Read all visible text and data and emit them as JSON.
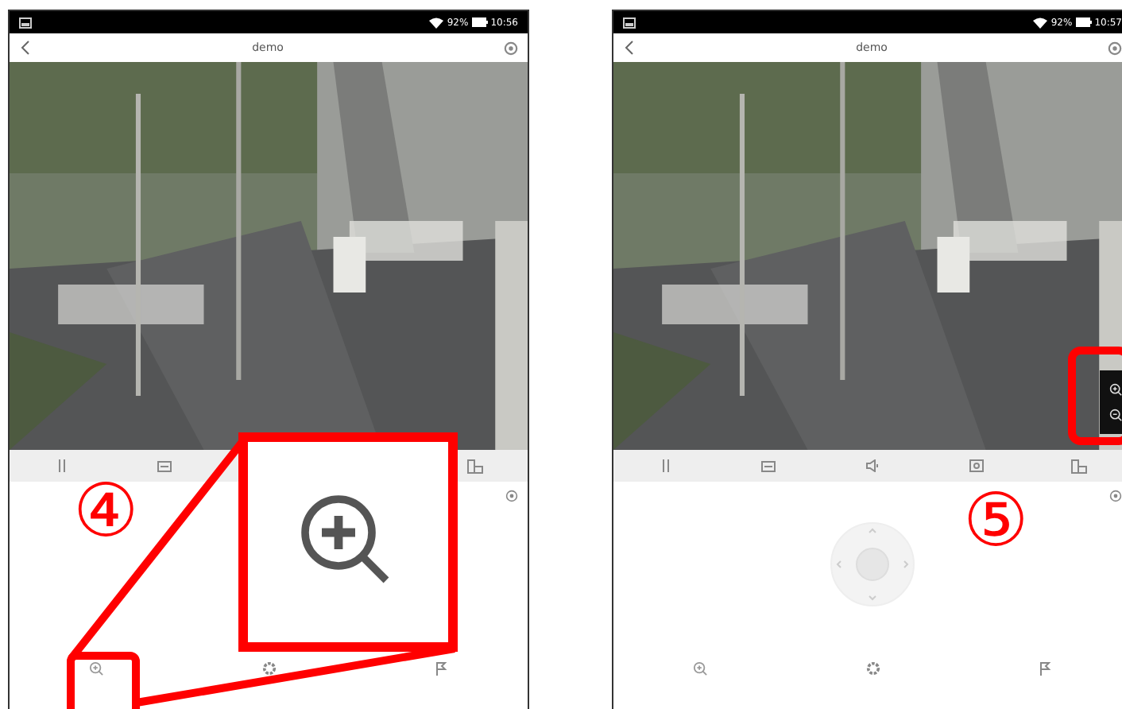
{
  "phones": [
    {
      "status": {
        "battery": "92%",
        "time": "10:56"
      },
      "title": "demo",
      "zoom_panel": false,
      "joystick": false,
      "toolbar": [
        {
          "kind": "pause"
        },
        {
          "kind": "film"
        },
        {
          "kind": "hidden"
        },
        {
          "kind": "hidden"
        },
        {
          "kind": "phone"
        }
      ],
      "bottom": [
        {
          "kind": "zoom"
        },
        {
          "kind": "preset"
        },
        {
          "kind": "flag"
        }
      ]
    },
    {
      "status": {
        "battery": "92%",
        "time": "10:57"
      },
      "title": "demo",
      "zoom_panel": true,
      "joystick": true,
      "toolbar": [
        {
          "kind": "pause"
        },
        {
          "kind": "film"
        },
        {
          "kind": "speaker"
        },
        {
          "kind": "snapshot"
        },
        {
          "kind": "phone"
        }
      ],
      "bottom": [
        {
          "kind": "zoom"
        },
        {
          "kind": "preset"
        },
        {
          "kind": "flag"
        }
      ]
    }
  ],
  "annotations": [
    {
      "label": "④"
    },
    {
      "label": "⑤"
    }
  ]
}
